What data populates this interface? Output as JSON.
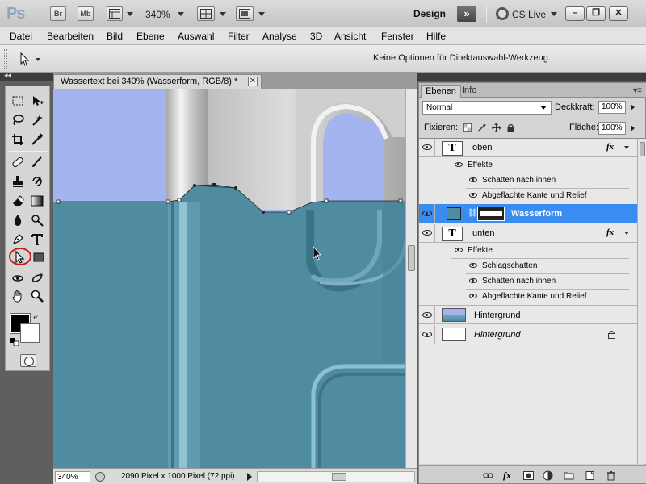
{
  "app": {
    "logo": "Ps",
    "bridge_label": "Br",
    "minibridge_label": "Mb",
    "zoom": "340%",
    "workspace_label": "Design",
    "workspace_switch_label": "»",
    "cslive_label": "CS Live"
  },
  "menu": [
    "Datei",
    "Bearbeiten",
    "Bild",
    "Ebene",
    "Auswahl",
    "Filter",
    "Analyse",
    "3D",
    "Ansicht",
    "Fenster",
    "Hilfe"
  ],
  "options_bar": {
    "hint": "Keine Optionen für Direktauswahl-Werkzeug."
  },
  "document": {
    "tab_title": "Wassertext bei 340% (Wasserform, RGB/8) *",
    "close_label": "✕",
    "status_zoom": "340%",
    "status_info": "2090 Pixel x 1000 Pixel (72 ppi)"
  },
  "colors": {
    "water": "#4f8ba1",
    "sky": "#a3b4ee",
    "selection": "#3a8cf0",
    "highlight_circle": "#c81a1a"
  },
  "layers_panel": {
    "tabs": [
      "Ebenen",
      "Info"
    ],
    "blend_mode": "Normal",
    "opacity_label": "Deckkraft:",
    "opacity_value": "100%",
    "lock_label": "Fixieren:",
    "fill_label": "Fläche:",
    "fill_value": "100%",
    "effects_label": "Effekte",
    "layers": [
      {
        "name": "oben",
        "type": "text",
        "thumb_text": "T",
        "fx": "fx",
        "effects": [
          "Schatten nach innen",
          "Abgeflachte Kante und Relief"
        ]
      },
      {
        "name": "Wasserform",
        "type": "shape",
        "selected": true
      },
      {
        "name": "unten",
        "type": "text",
        "thumb_text": "T",
        "fx": "fx",
        "effects": [
          "Schlagschatten",
          "Schatten nach innen",
          "Abgeflachte Kante und Relief"
        ]
      },
      {
        "name": "Hintergrund",
        "type": "gradient"
      },
      {
        "name": "Hintergrund",
        "type": "background",
        "italic": true,
        "locked": true
      }
    ]
  }
}
